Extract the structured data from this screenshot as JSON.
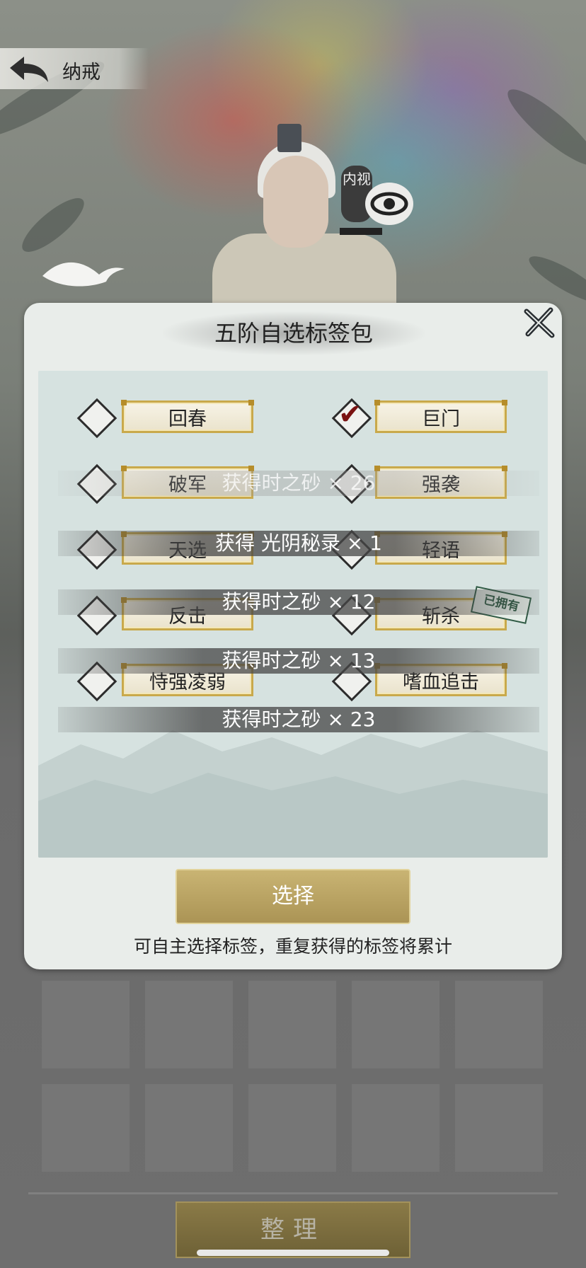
{
  "header": {
    "title": "纳戒"
  },
  "eye_button": {
    "label": "内视"
  },
  "dialog": {
    "title": "五阶自选标签包",
    "tags": [
      {
        "label": "回春",
        "checked": false
      },
      {
        "label": "巨门",
        "checked": true
      },
      {
        "label": "破军",
        "checked": false
      },
      {
        "label": "强袭",
        "checked": false
      },
      {
        "label": "天选",
        "checked": false
      },
      {
        "label": "轻语",
        "checked": false
      },
      {
        "label": "反击",
        "checked": false
      },
      {
        "label": "斩杀",
        "checked": false,
        "owned": true
      },
      {
        "label": "恃强凌弱",
        "checked": false
      },
      {
        "label": "嗜血追击",
        "checked": false
      }
    ],
    "owned_stamp": "已拥有",
    "check_glyph": "✔",
    "select_label": "选择",
    "hint": "可自主选择标签，重复获得的标签将累计"
  },
  "toasts": [
    {
      "text": "获得时之砂 × 26"
    },
    {
      "text": "获得 光阴秘录 × 1"
    },
    {
      "text": "获得时之砂 × 12"
    },
    {
      "text": "获得时之砂 × 13"
    },
    {
      "text": "获得时之砂 × 23"
    }
  ],
  "inventory": {
    "organize_label": "整理",
    "slot_count": 10
  },
  "colors": {
    "gold_accent": "#c9a94b",
    "check_red": "#7a1212",
    "panel": "#d6e2e0"
  }
}
